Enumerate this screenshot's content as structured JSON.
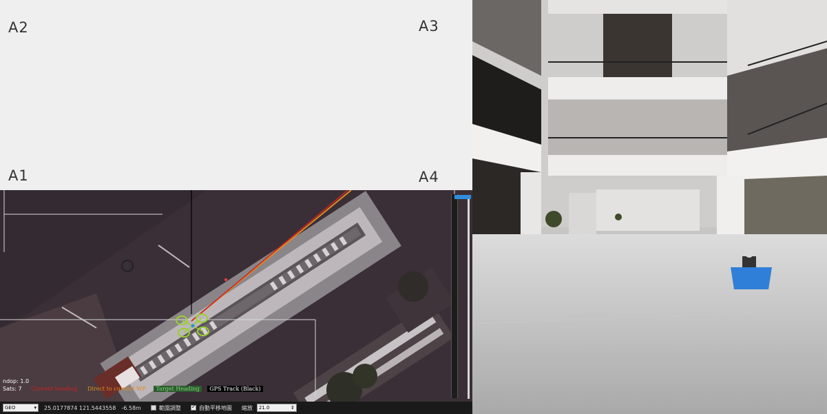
{
  "corner_labels": {
    "a1": "A1",
    "a2": "A2",
    "a3": "A3",
    "a4": "A4"
  },
  "map": {
    "hdop_label": "ndop: 1.0",
    "sats_label": "Sats: 7",
    "legend": {
      "current_heading": "Current heading",
      "direct_to_wp": "Direct to current WP",
      "target_heading": "Target Heading",
      "gps_track": "GPS Track (Black)"
    },
    "colors": {
      "current_heading": "#cc2222",
      "direct_to_wp": "#e08a1e",
      "target_heading": "#2a9a2a",
      "gps_track": "#000000"
    }
  },
  "statusbar": {
    "mode_select": "GEO",
    "coordinates": "25.0177874 121.5443558",
    "altitude": "-6.58m",
    "checkbox1_label": "範圍調整",
    "checkbox2_label": "自動平移地圖",
    "zoom_label": "縮放",
    "zoom_value": "21.0"
  },
  "slider": {
    "accent": "#2f8fdc"
  }
}
